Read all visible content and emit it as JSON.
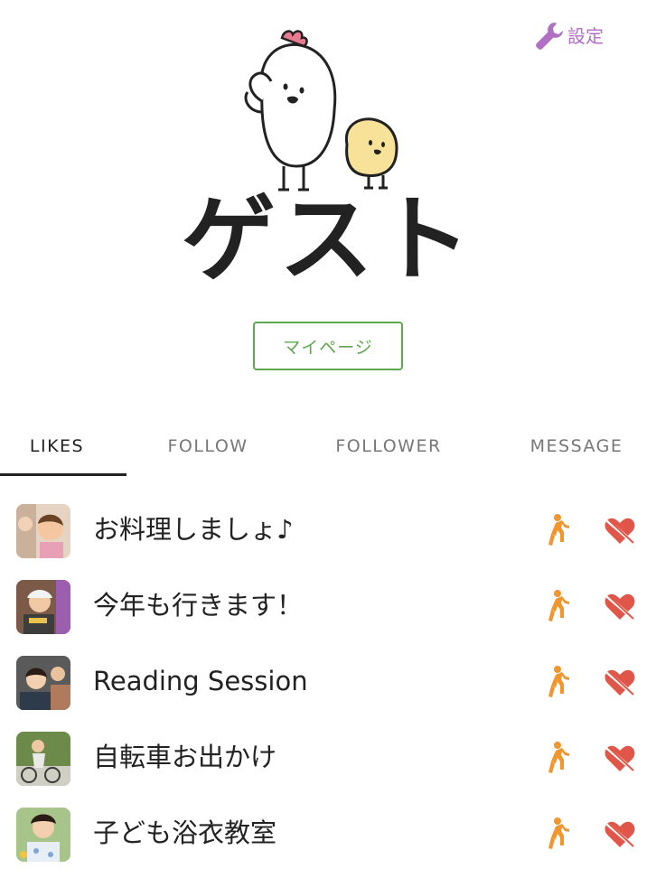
{
  "header": {
    "settings": {
      "label": "設定",
      "icon": "wrench-icon",
      "color": "#b06fc4"
    }
  },
  "profile": {
    "mascot": "chicken-and-chick-illustration",
    "name": "ゲスト",
    "mypage_button": "マイページ",
    "button_color": "#5fa84f"
  },
  "tabs": [
    {
      "label": "LIKES",
      "active": true
    },
    {
      "label": "FOLLOW",
      "active": false
    },
    {
      "label": "FOLLOWER",
      "active": false
    },
    {
      "label": "MESSAGE",
      "active": false
    }
  ],
  "likes": [
    {
      "title": "お料理しましょ♪",
      "thumb_icon": "child-photo-icon"
    },
    {
      "title": "今年も行きます！",
      "thumb_icon": "festival-photo-icon"
    },
    {
      "title": "Reading Session",
      "thumb_icon": "group-photo-icon"
    },
    {
      "title": "自転車お出かけ",
      "thumb_icon": "bicycle-photo-icon"
    },
    {
      "title": "子ども浴衣教室",
      "thumb_icon": "yukata-photo-icon"
    }
  ],
  "actions": {
    "walk_icon": "walking-person-icon",
    "walk_color": "#f0962d",
    "unlike_icon": "broken-heart-icon",
    "unlike_color": "#e0574a"
  }
}
